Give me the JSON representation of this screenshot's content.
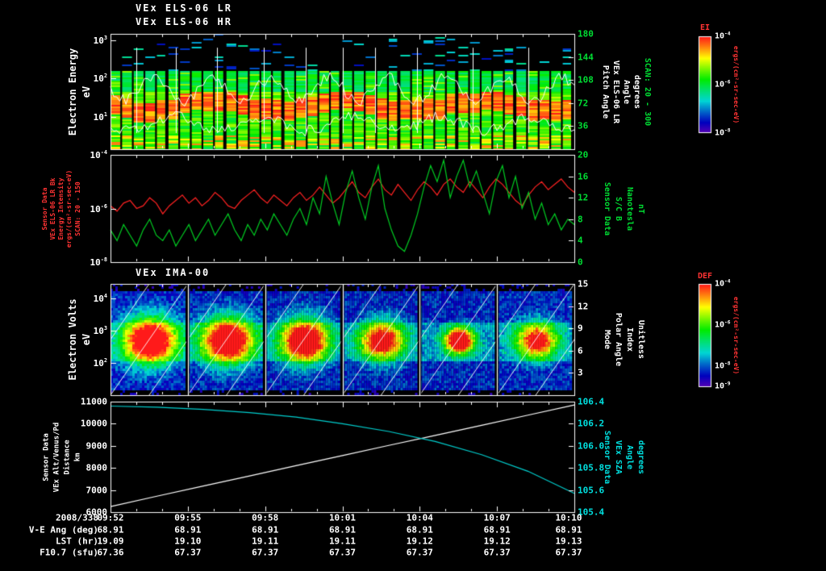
{
  "colors": {
    "background": "#000000",
    "foreground": "#ffffff",
    "green": "#00dd33",
    "red": "#ff3333",
    "cyan": "#00e0e0",
    "trace_red": "#ff2222",
    "trace_green": "#00cc22",
    "trace_cyan": "#00cfcf"
  },
  "panels": {
    "els": {
      "titles": [
        "VEx ELS-06 LR",
        "VEx ELS-06 HR"
      ],
      "left_label": [
        "Electron Energy",
        "eV"
      ],
      "left_ticks": [
        "10^3",
        "10^2",
        "10^1"
      ],
      "right_label": [
        "Pitch Angle",
        "VEx ELS-06 LR",
        "Angle",
        "degrees",
        "SCAN: 20 - 300"
      ],
      "right_ticks": [
        "180",
        "144",
        "108",
        "72",
        "36"
      ]
    },
    "sensor_b": {
      "left_label": [
        "Sensor Data",
        "VEx ELS-06 LR Bk",
        "Energy Intensity",
        "ergs/(cm²-sr-sec-eV)",
        "SCAN: 20 - 150"
      ],
      "left_ticks": [
        "10^-4",
        "10^-6",
        "10^-8"
      ],
      "right_label": [
        "Sensor Data",
        "S/C B",
        "Nanotesla",
        "nT"
      ],
      "right_ticks": [
        "20",
        "16",
        "12",
        "8",
        "4",
        "0"
      ]
    },
    "ima": {
      "title": "VEx IMA-00",
      "left_label": [
        "Electron Volts",
        "eV"
      ],
      "left_ticks": [
        "10^4",
        "10^3",
        "10^2"
      ],
      "right_label": [
        "Mode",
        "Polar Angle",
        "Index",
        "Unitless"
      ],
      "right_ticks": [
        "15",
        "12",
        "9",
        "6",
        "3"
      ]
    },
    "traj": {
      "left_label": [
        "Sensor Data",
        "VEx Alt/Venus/Pd",
        "Distance",
        "km"
      ],
      "left_ticks": [
        "11000",
        "10000",
        "9000",
        "8000",
        "7000",
        "6000"
      ],
      "right_label": [
        "Sensor Data",
        "VEx SZA",
        "Angle",
        "degrees"
      ],
      "right_ticks": [
        "106.4",
        "106.2",
        "106.0",
        "105.8",
        "105.6",
        "105.4"
      ]
    }
  },
  "colorbars": [
    {
      "label": "EI",
      "ticks": [
        "10^-4",
        "10^-6",
        "10^-8"
      ],
      "units": "ergs/(cm²-sr-sec-eV)"
    },
    {
      "label": "DEF",
      "ticks": [
        "10^-4",
        "10^-6",
        "10^-8",
        "10^-9"
      ],
      "units": "ergs/(cm²-sr-sec-eV)"
    }
  ],
  "bottom_axis": {
    "date": "2008/338",
    "times": [
      "09:52",
      "09:55",
      "09:58",
      "10:01",
      "10:04",
      "10:07",
      "10:10"
    ],
    "rows": [
      {
        "label": "V-E Ang (deg)",
        "values": [
          "68.91",
          "68.91",
          "68.91",
          "68.91",
          "68.91",
          "68.91",
          "68.91"
        ]
      },
      {
        "label": "LST (hr)",
        "values": [
          "19.09",
          "19.10",
          "19.11",
          "19.11",
          "19.12",
          "19.12",
          "19.13"
        ]
      },
      {
        "label": "F10.7 (sfu)",
        "values": [
          "67.36",
          "67.37",
          "67.37",
          "67.37",
          "67.37",
          "67.37",
          "67.37"
        ]
      }
    ]
  },
  "chart_data": [
    {
      "type": "heatmap",
      "panel": "els_electron_spectrogram",
      "title": "VEx ELS-06 LR / VEx ELS-06 HR",
      "date": "2008/338",
      "x_start": "09:52",
      "x_end": "10:10",
      "ylabel": "Electron Energy (eV)",
      "y_scale": "log",
      "y_range_eV": [
        1,
        1000
      ],
      "right_axis": {
        "label": "Pitch Angle VEx ELS-06 LR Angle degrees SCAN: 20 - 300",
        "range": [
          0,
          180
        ],
        "ticks": [
          180,
          144,
          108,
          72,
          36
        ]
      },
      "color_scale": {
        "label": "EI",
        "units": "ergs/(cm²-sr-sec-eV)",
        "range_log10": [
          -8,
          -4
        ]
      },
      "features": [
        "about 40 vertical scan columns separated by thin black gaps",
        "intense red band (~10^-4) near 8-30 eV across the whole interval",
        "moderate green flux 30-200 eV above and below the band",
        "sparse blue/cyan speckle above ~300 eV",
        "white pitch-angle line traces overplotted with vertical spikes"
      ]
    },
    {
      "type": "line",
      "panel": "bk_intensity_and_magnetic_field",
      "x_start": "09:52",
      "x_end": "10:10",
      "points_evenly_spaced": true,
      "series": [
        {
          "name": "VEx ELS-06 LR Bk Energy Intensity",
          "units": "ergs/(cm²-sr-sec-eV)",
          "color": "#ff2222",
          "scale": "log",
          "axis_range_log10": [
            -8,
            -4
          ],
          "log10_values": [
            -5.9,
            -6.1,
            -5.8,
            -5.7,
            -6.0,
            -5.9,
            -5.6,
            -5.8,
            -6.2,
            -5.9,
            -5.7,
            -5.5,
            -5.8,
            -5.6,
            -5.9,
            -5.7,
            -5.4,
            -5.6,
            -5.9,
            -6.0,
            -5.7,
            -5.5,
            -5.3,
            -5.6,
            -5.8,
            -5.5,
            -5.7,
            -5.9,
            -5.6,
            -5.4,
            -5.7,
            -5.5,
            -5.2,
            -5.5,
            -5.8,
            -5.6,
            -5.3,
            -5.0,
            -5.4,
            -5.6,
            -5.2,
            -4.9,
            -5.3,
            -5.5,
            -5.1,
            -5.4,
            -5.7,
            -5.3,
            -5.0,
            -5.2,
            -5.5,
            -5.1,
            -4.9,
            -5.2,
            -5.4,
            -5.0,
            -5.3,
            -5.6,
            -5.2,
            -4.9,
            -5.1,
            -5.4,
            -5.7,
            -5.9,
            -5.5,
            -5.2,
            -5.0,
            -5.3,
            -5.1,
            -4.9,
            -5.2,
            -5.4
          ]
        },
        {
          "name": "S/C B",
          "units": "nT",
          "color": "#00cc22",
          "axis_range": [
            0,
            20
          ],
          "values": [
            6,
            4,
            7,
            5,
            3,
            6,
            8,
            5,
            4,
            6,
            3,
            5,
            7,
            4,
            6,
            8,
            5,
            7,
            9,
            6,
            4,
            7,
            5,
            8,
            6,
            9,
            7,
            5,
            8,
            10,
            7,
            12,
            9,
            16,
            11,
            7,
            13,
            17,
            12,
            8,
            14,
            18,
            10,
            6,
            3,
            2,
            5,
            9,
            14,
            18,
            15,
            19,
            12,
            16,
            19,
            14,
            17,
            13,
            9,
            15,
            18,
            12,
            16,
            10,
            13,
            8,
            11,
            7,
            9,
            6,
            8,
            7
          ]
        }
      ]
    },
    {
      "type": "heatmap",
      "panel": "ima_ion_spectrogram",
      "title": "VEx IMA-00",
      "x_start": "09:52",
      "x_end": "10:10",
      "ylabel": "Electron Volts (eV)",
      "y_scale": "log",
      "y_range_eV": [
        10,
        30000
      ],
      "right_axis": {
        "label": "Mode Polar Angle Index Unitless",
        "range": [
          0,
          15
        ],
        "ticks": [
          15,
          12,
          9,
          6,
          3
        ]
      },
      "color_scale": {
        "label": "DEF",
        "units": "ergs/(cm²-sr-sec-eV)",
        "range_log10": [
          -9,
          -4
        ]
      },
      "cycle_peak_intensity": [
        0.95,
        0.92,
        0.9,
        0.74,
        1.0,
        0.68
      ],
      "features": [
        "6 scan cycles (~3 min each) separated by white vertical lines",
        "blue background flux with enhanced teal band 100-1000 eV",
        "bright green/yellow ion blobs each cycle near 300 eV with red cores in cycles 1-3 and 5",
        "white diagonal polar-angle sweep line crossing each cycle"
      ]
    },
    {
      "type": "line",
      "panel": "trajectory",
      "x_start": "09:52",
      "x_end": "10:10",
      "points_evenly_spaced": true,
      "series": [
        {
          "name": "VEx Alt/Venus/Pd Distance",
          "units": "km",
          "color": "#ffffff",
          "axis_range": [
            6000,
            11000
          ],
          "values": [
            6250,
            6720,
            7180,
            7640,
            8100,
            8560,
            9020,
            9470,
            9930,
            10390,
            10850
          ]
        },
        {
          "name": "VEx SZA Angle",
          "units": "degrees",
          "color": "#00cfcf",
          "axis_range": [
            105.4,
            106.4
          ],
          "values": [
            106.36,
            106.35,
            106.33,
            106.3,
            106.26,
            106.2,
            106.13,
            106.04,
            105.92,
            105.77,
            105.57
          ]
        }
      ]
    }
  ]
}
